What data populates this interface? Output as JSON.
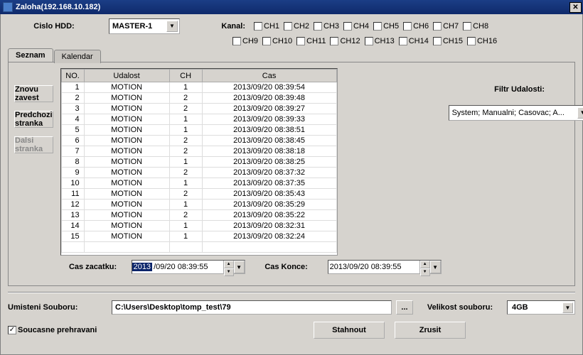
{
  "title": "Zaloha(192.168.10.182)",
  "hdd_label": "Cislo HDD:",
  "hdd_value": "MASTER-1",
  "kanal_label": "Kanal:",
  "channels_top": [
    "CH1",
    "CH2",
    "CH3",
    "CH4",
    "CH5",
    "CH6",
    "CH7",
    "CH8"
  ],
  "channels_bot": [
    "CH9",
    "CH10",
    "CH11",
    "CH12",
    "CH13",
    "CH14",
    "CH15",
    "CH16"
  ],
  "tabs": {
    "seznam": "Seznam",
    "kalendar": "Kalendar"
  },
  "buttons": {
    "reload": "Znovu zavest",
    "prev": "Predchozi stranka",
    "next": "Dalsi stranka",
    "download": "Stahnout",
    "cancel": "Zrusit"
  },
  "table": {
    "headers": {
      "no": "NO.",
      "udalost": "Udalost",
      "ch": "CH",
      "cas": "Cas"
    },
    "rows": [
      {
        "no": "1",
        "u": "MOTION",
        "ch": "1",
        "c": "2013/09/20 08:39:54"
      },
      {
        "no": "2",
        "u": "MOTION",
        "ch": "2",
        "c": "2013/09/20 08:39:48"
      },
      {
        "no": "3",
        "u": "MOTION",
        "ch": "2",
        "c": "2013/09/20 08:39:27"
      },
      {
        "no": "4",
        "u": "MOTION",
        "ch": "1",
        "c": "2013/09/20 08:39:33"
      },
      {
        "no": "5",
        "u": "MOTION",
        "ch": "1",
        "c": "2013/09/20 08:38:51"
      },
      {
        "no": "6",
        "u": "MOTION",
        "ch": "2",
        "c": "2013/09/20 08:38:45"
      },
      {
        "no": "7",
        "u": "MOTION",
        "ch": "2",
        "c": "2013/09/20 08:38:18"
      },
      {
        "no": "8",
        "u": "MOTION",
        "ch": "1",
        "c": "2013/09/20 08:38:25"
      },
      {
        "no": "9",
        "u": "MOTION",
        "ch": "2",
        "c": "2013/09/20 08:37:32"
      },
      {
        "no": "10",
        "u": "MOTION",
        "ch": "1",
        "c": "2013/09/20 08:37:35"
      },
      {
        "no": "11",
        "u": "MOTION",
        "ch": "2",
        "c": "2013/09/20 08:35:43"
      },
      {
        "no": "12",
        "u": "MOTION",
        "ch": "1",
        "c": "2013/09/20 08:35:29"
      },
      {
        "no": "13",
        "u": "MOTION",
        "ch": "2",
        "c": "2013/09/20 08:35:22"
      },
      {
        "no": "14",
        "u": "MOTION",
        "ch": "1",
        "c": "2013/09/20 08:32:31"
      },
      {
        "no": "15",
        "u": "MOTION",
        "ch": "1",
        "c": "2013/09/20 08:32:24"
      }
    ]
  },
  "filter": {
    "label": "Filtr Udalosti:",
    "value": "System; Manualni; Casovac; A..."
  },
  "cas_zacatku_label": "Cas zacatku:",
  "cas_zacatku_sel": "2013",
  "cas_zacatku_rest": "/09/20 08:39:55",
  "cas_konce_label": "Cas Konce:",
  "cas_konce": "2013/09/20 08:39:55",
  "umisteni_label": "Umisteni Souboru:",
  "umisteni_value": "C:\\Users\\Desktop\\tomp_test\\79",
  "velikost_label": "Velikost souboru:",
  "velikost_value": "4GB",
  "soucasne_label": "Soucasne prehravani"
}
